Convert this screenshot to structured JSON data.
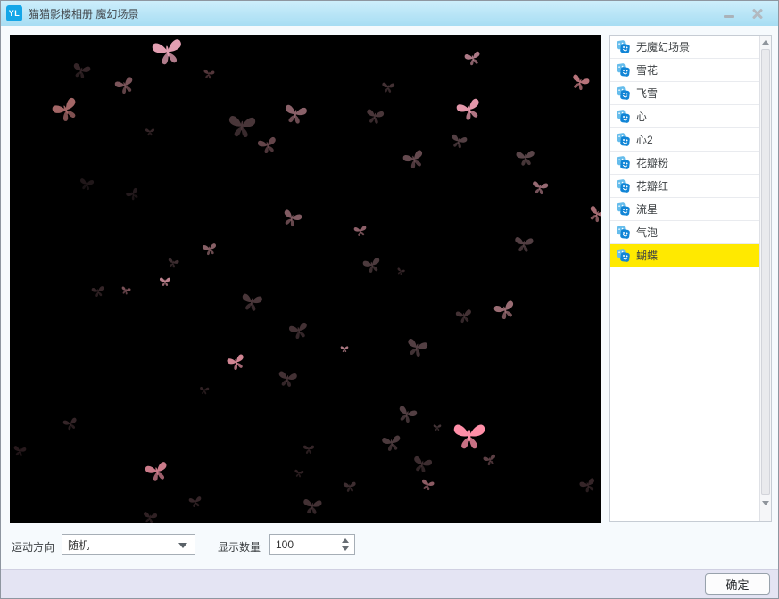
{
  "window": {
    "title": "猫猫影楼相册 魔幻场景",
    "icon_text": "YL"
  },
  "sidebar": {
    "items": [
      {
        "label": "无魔幻场景",
        "selected": false
      },
      {
        "label": "雪花",
        "selected": false
      },
      {
        "label": "飞雪",
        "selected": false
      },
      {
        "label": "心",
        "selected": false
      },
      {
        "label": "心2",
        "selected": false
      },
      {
        "label": "花瓣粉",
        "selected": false
      },
      {
        "label": "花瓣红",
        "selected": false
      },
      {
        "label": "流星",
        "selected": false
      },
      {
        "label": "气泡",
        "selected": false
      },
      {
        "label": "蝴蝶",
        "selected": true
      }
    ]
  },
  "controls": {
    "direction_label": "运动方向",
    "direction_value": "随机",
    "count_label": "显示数量",
    "count_value": "100"
  },
  "footer": {
    "ok_label": "确定"
  },
  "colors": {
    "titlebar": "#a7ddf3",
    "selected_row": "#ffe900",
    "accent_blue": "#1185d6",
    "preview_bg": "#000000",
    "footer_bg": "#e4e4f3"
  },
  "preview": {
    "butterflies": [
      [
        177,
        19,
        38,
        -10,
        "#f0a8bc",
        0.95
      ],
      [
        80,
        40,
        22,
        15,
        "#6a4a50",
        0.5
      ],
      [
        129,
        57,
        24,
        -20,
        "#b07880",
        0.7
      ],
      [
        223,
        44,
        14,
        10,
        "#8a5a62",
        0.6
      ],
      [
        63,
        84,
        32,
        -25,
        "#c07878",
        0.85
      ],
      [
        260,
        102,
        34,
        5,
        "#7a5a60",
        0.6
      ],
      [
        320,
        89,
        28,
        10,
        "#b8828c",
        0.75
      ],
      [
        289,
        124,
        24,
        -15,
        "#9a6a72",
        0.65
      ],
      [
        157,
        109,
        12,
        0,
        "#6a4a50",
        0.5
      ],
      [
        86,
        167,
        18,
        10,
        "#503a40",
        0.4
      ],
      [
        138,
        179,
        16,
        -30,
        "#503a40",
        0.45
      ],
      [
        316,
        206,
        24,
        20,
        "#b8828c",
        0.7
      ],
      [
        224,
        240,
        18,
        -10,
        "#c08890",
        0.7
      ],
      [
        183,
        256,
        14,
        15,
        "#7a5a60",
        0.5
      ],
      [
        519,
        26,
        20,
        -15,
        "#d898a8",
        0.8
      ],
      [
        639,
        53,
        22,
        20,
        "#d88890",
        0.85
      ],
      [
        424,
        59,
        16,
        5,
        "#7a5a60",
        0.55
      ],
      [
        515,
        84,
        30,
        -20,
        "#f0a0b4",
        0.95
      ],
      [
        409,
        91,
        22,
        10,
        "#7a5a60",
        0.6
      ],
      [
        503,
        119,
        20,
        15,
        "#8a6a70",
        0.6
      ],
      [
        578,
        138,
        24,
        -5,
        "#8a6a70",
        0.65
      ],
      [
        453,
        140,
        26,
        -20,
        "#9a7078",
        0.65
      ],
      [
        594,
        171,
        20,
        10,
        "#c88c98",
        0.75
      ],
      [
        658,
        201,
        22,
        25,
        "#d08890",
        0.8
      ],
      [
        393,
        220,
        16,
        -10,
        "#c88894",
        0.7
      ],
      [
        576,
        235,
        24,
        5,
        "#8a6a70",
        0.6
      ],
      [
        406,
        258,
        22,
        -15,
        "#8a6a70",
        0.55
      ],
      [
        438,
        265,
        10,
        20,
        "#6a4a50",
        0.5
      ],
      [
        99,
        288,
        16,
        -10,
        "#6a4a50",
        0.5
      ],
      [
        130,
        287,
        12,
        15,
        "#b87a84",
        0.65
      ],
      [
        174,
        277,
        14,
        0,
        "#e09aa8",
        0.85
      ],
      [
        271,
        300,
        26,
        10,
        "#7a5a60",
        0.6
      ],
      [
        324,
        332,
        24,
        -15,
        "#7a5a60",
        0.55
      ],
      [
        375,
        352,
        10,
        0,
        "#d898a4",
        0.8
      ],
      [
        254,
        367,
        22,
        -20,
        "#e894a4",
        0.9
      ],
      [
        311,
        386,
        24,
        10,
        "#7a5a60",
        0.55
      ],
      [
        218,
        399,
        12,
        5,
        "#6a4a50",
        0.45
      ],
      [
        456,
        351,
        26,
        15,
        "#8a6a70",
        0.6
      ],
      [
        509,
        315,
        20,
        -10,
        "#7a5a60",
        0.55
      ],
      [
        555,
        309,
        26,
        -20,
        "#c08890",
        0.8
      ],
      [
        445,
        426,
        24,
        20,
        "#8a6a70",
        0.6
      ],
      [
        479,
        440,
        10,
        0,
        "#8a6a70",
        0.5
      ],
      [
        515,
        450,
        40,
        0,
        "#ff8fa8",
        1
      ],
      [
        538,
        477,
        16,
        -15,
        "#9a6a72",
        0.6
      ],
      [
        428,
        458,
        24,
        -10,
        "#8a6a70",
        0.55
      ],
      [
        462,
        482,
        24,
        15,
        "#7a5a60",
        0.5
      ],
      [
        68,
        436,
        18,
        -15,
        "#6a4a50",
        0.5
      ],
      [
        11,
        467,
        16,
        10,
        "#5a3a42",
        0.45
      ],
      [
        335,
        465,
        14,
        0,
        "#6a4a50",
        0.5
      ],
      [
        165,
        490,
        28,
        -15,
        "#e08898",
        0.9
      ],
      [
        324,
        492,
        12,
        10,
        "#6a4a50",
        0.45
      ],
      [
        381,
        507,
        16,
        -5,
        "#7a5a60",
        0.5
      ],
      [
        468,
        505,
        16,
        15,
        "#c8828e",
        0.7
      ],
      [
        208,
        524,
        16,
        -10,
        "#6a4a50",
        0.5
      ],
      [
        339,
        529,
        24,
        5,
        "#7a5a60",
        0.55
      ],
      [
        157,
        541,
        18,
        10,
        "#6a4a50",
        0.45
      ],
      [
        648,
        505,
        20,
        -20,
        "#6a4a50",
        0.5
      ]
    ]
  }
}
